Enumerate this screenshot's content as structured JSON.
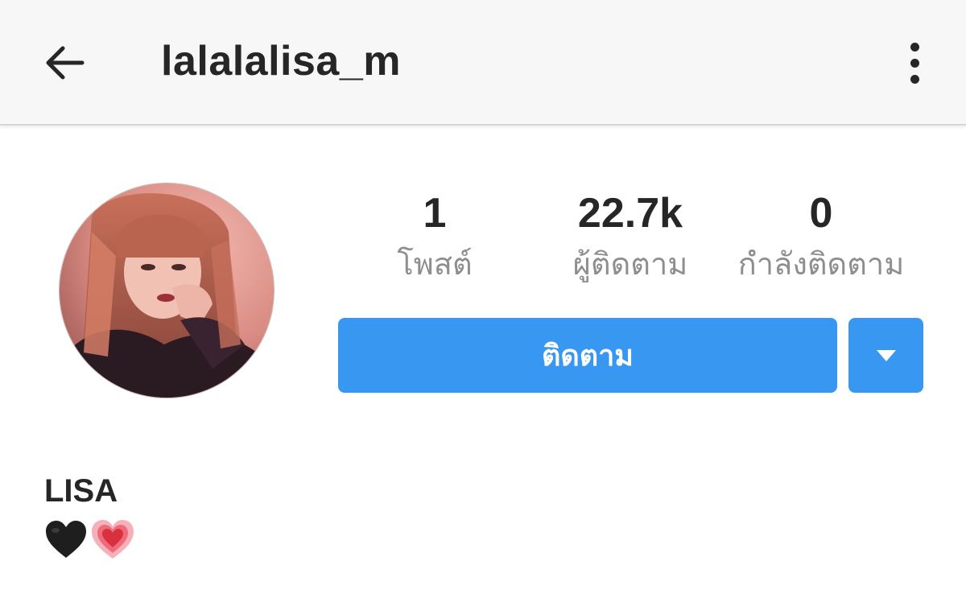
{
  "header": {
    "back_icon": "arrow-left-icon",
    "username": "lalalalisa_m",
    "more_icon": "vertical-dots-icon"
  },
  "profile": {
    "avatar": "profile-photo",
    "stats": [
      {
        "value": "1",
        "label": "โพสต์"
      },
      {
        "value": "22.7k",
        "label": "ผู้ติดตาม"
      },
      {
        "value": "0",
        "label": "กำลังติดตาม"
      }
    ],
    "follow_label": "ติดตาม",
    "dropdown_icon": "triangle-down-icon",
    "display_name": "LISA",
    "bio_icons": [
      "black-heart-icon",
      "growing-heart-icon"
    ]
  },
  "colors": {
    "accent": "#3897f0",
    "header_bg": "#f7f7f7",
    "text_primary": "#262626",
    "text_secondary": "#8e8e8e"
  }
}
